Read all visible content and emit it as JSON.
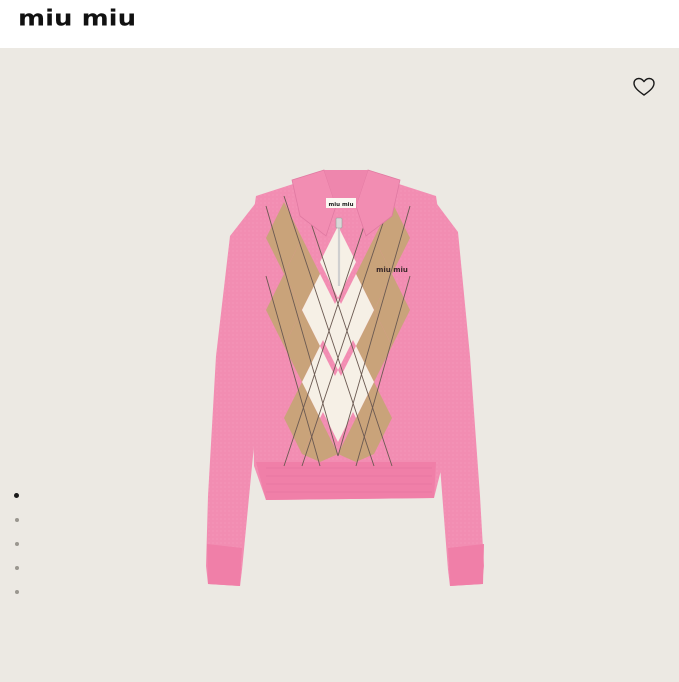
{
  "header": {
    "logo_text": "miu miu"
  },
  "product": {
    "image_label": "miu miu",
    "logo_on_product": "miu miu"
  },
  "gallery": {
    "slides": [
      {
        "active": true
      },
      {
        "active": false
      },
      {
        "active": false
      },
      {
        "active": false
      },
      {
        "active": false
      }
    ]
  },
  "colors": {
    "background": "#ece9e3",
    "sweater_pink": "#f08cb0",
    "argyle_tan": "#c9a37a",
    "argyle_cream": "#f6f0e6"
  },
  "icons": {
    "wishlist": "heart-icon"
  }
}
